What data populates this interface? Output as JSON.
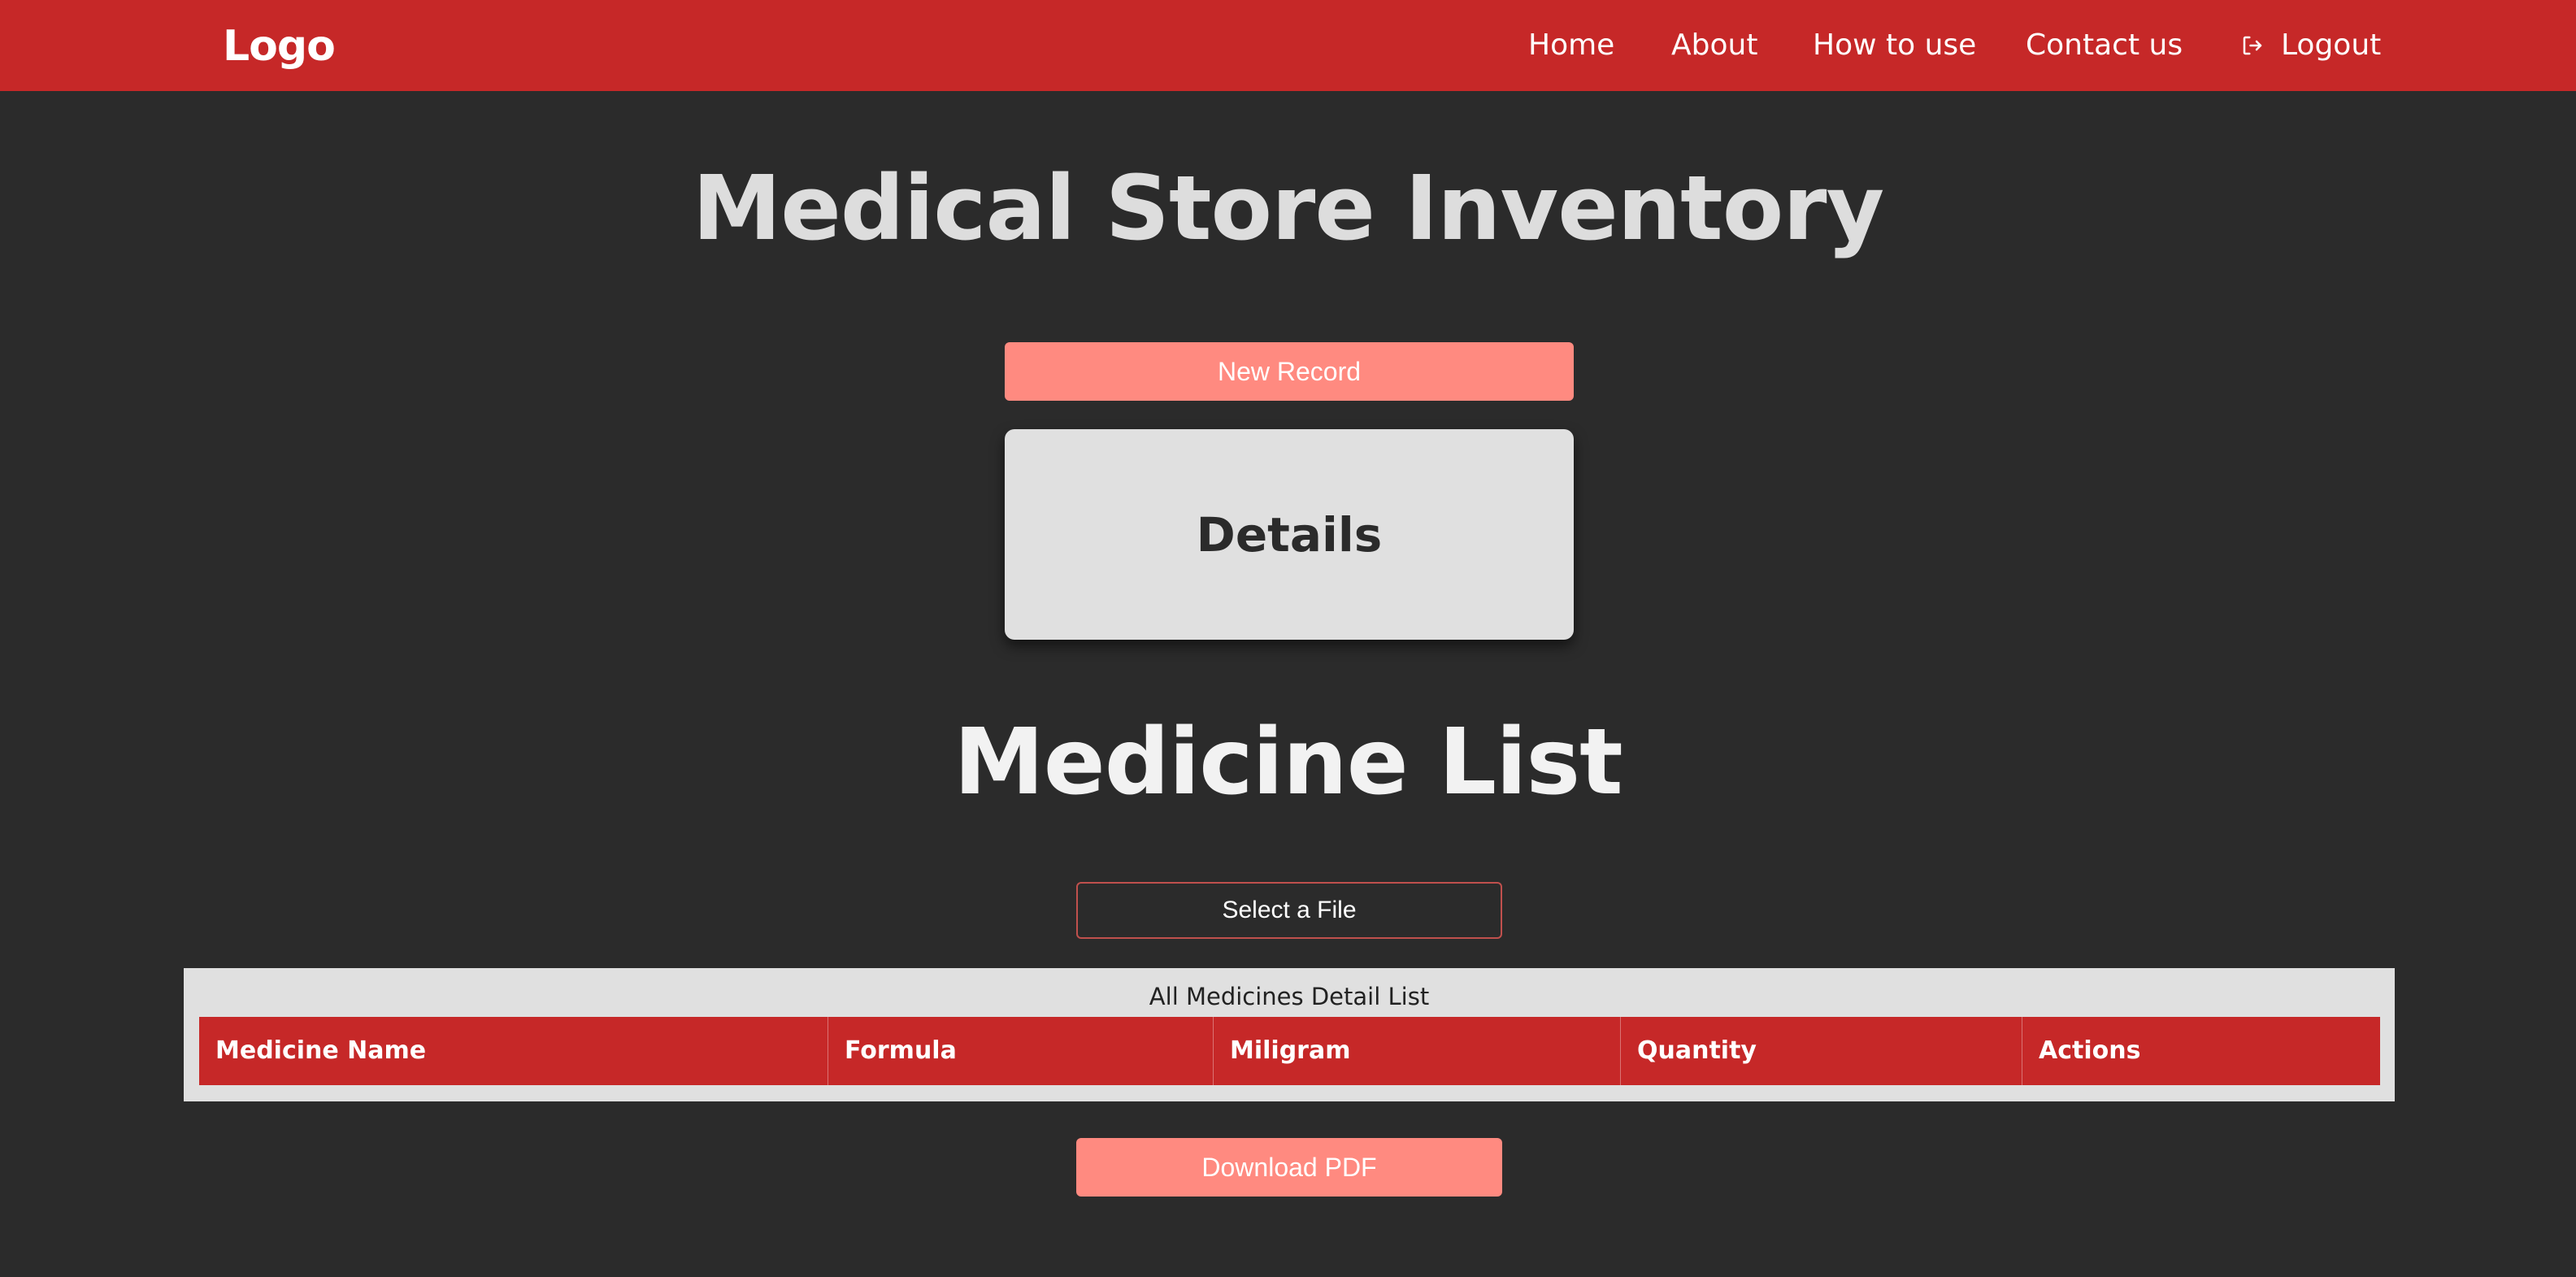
{
  "navbar": {
    "logo": "Logo",
    "links": {
      "home": "Home",
      "about": "About",
      "how_to_use": "How to use",
      "contact": "Contact us",
      "logout": "Logout"
    },
    "logout_icon": "logout-icon"
  },
  "header": {
    "title": "Medical Store Inventory"
  },
  "actions": {
    "new_record_label": "New Record"
  },
  "details_card": {
    "title": "Details"
  },
  "medicine_list": {
    "title": "Medicine List",
    "select_file_label": "Select a File",
    "table": {
      "caption": "All Medicines Detail List",
      "columns": [
        "Medicine Name",
        "Formula",
        "Miligram",
        "Quantity",
        "Actions"
      ],
      "rows": []
    },
    "download_pdf_label": "Download PDF"
  },
  "colors": {
    "navbar": "#c62828",
    "background": "#2b2b2b",
    "button": "#ff8a80",
    "card": "#e0e0e0",
    "table_header": "#c62828"
  }
}
